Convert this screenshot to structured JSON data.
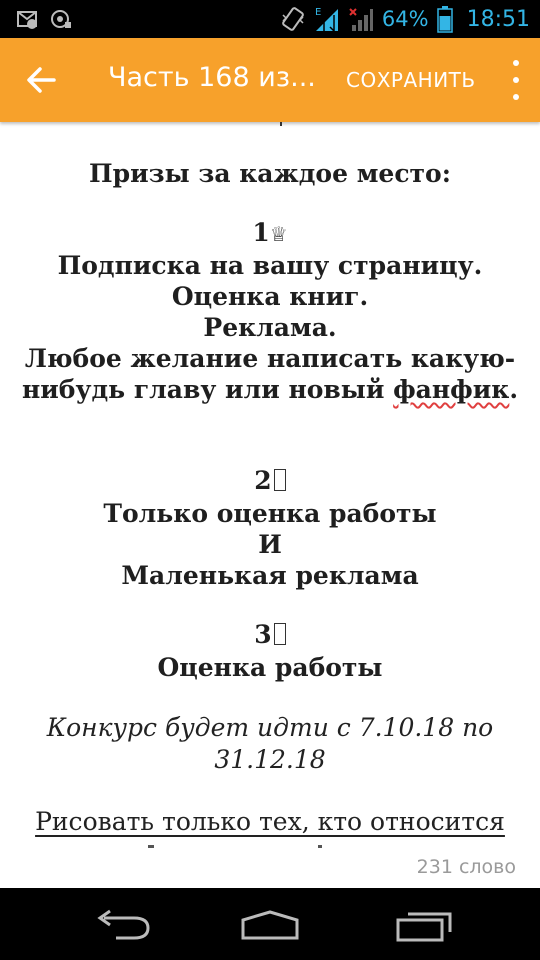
{
  "status_bar": {
    "battery": "64%",
    "time": "18:51",
    "icons": [
      "k-notification-icon",
      "mail-icon",
      "vibrate-icon",
      "signal-e-icon",
      "signal-x-icon",
      "battery-icon"
    ],
    "color": "#33b5e5"
  },
  "app_bar": {
    "title": "Часть 168 из...",
    "save_label": "СОХРАНИТЬ",
    "color": "#f7a12b"
  },
  "content": {
    "heading": "Призы за каждое место:",
    "place1": {
      "number": "1",
      "lines": [
        "Подписка на вашу страницу.",
        "Оценка книг.",
        "Реклама.",
        "Любое желание написать какую-",
        "нибудь главу или новый "
      ],
      "underlined_word": "фанфик",
      "end": "."
    },
    "place2": {
      "number": "2",
      "lines": [
        "Только оценка работы",
        "И",
        "Маленькая реклама"
      ]
    },
    "place3": {
      "number": "3",
      "lines": [
        "Оценка работы"
      ]
    },
    "contest_dates": [
      "Конкурс будет идти с 7.10.18 по",
      "31.12.18"
    ],
    "link_text": "Рисовать только тех, кто относится"
  },
  "word_count": "231 слово",
  "nav_bar": {
    "buttons": [
      "back-nav-icon",
      "home-nav-icon",
      "recent-apps-icon"
    ]
  }
}
